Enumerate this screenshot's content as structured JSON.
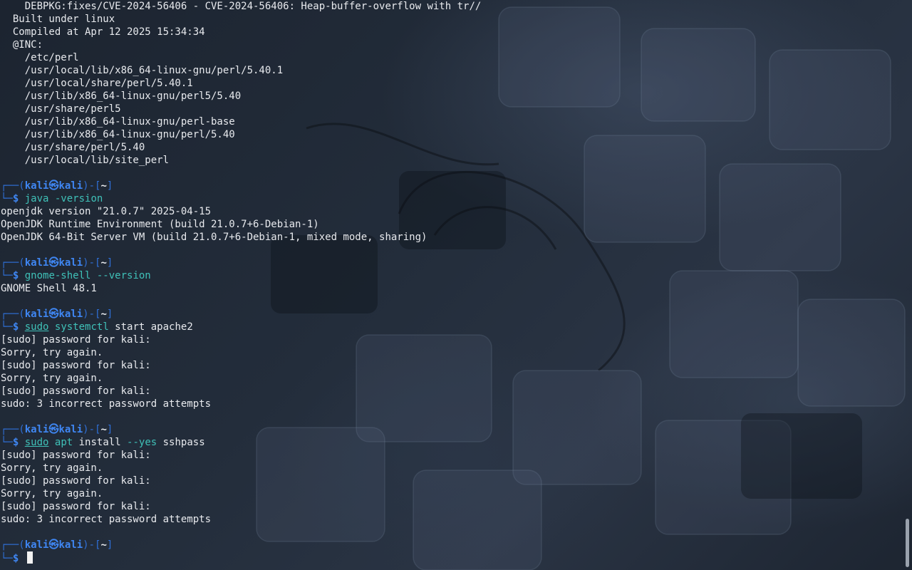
{
  "terminal": {
    "perl_output": [
      "    DEBPKG:fixes/CVE-2024-56406 - CVE-2024-56406: Heap-buffer-overflow with tr//",
      "  Built under linux",
      "  Compiled at Apr 12 2025 15:34:34",
      "  @INC:",
      "    /etc/perl",
      "    /usr/local/lib/x86_64-linux-gnu/perl/5.40.1",
      "    /usr/local/share/perl/5.40.1",
      "    /usr/lib/x86_64-linux-gnu/perl5/5.40",
      "    /usr/share/perl5",
      "    /usr/lib/x86_64-linux-gnu/perl-base",
      "    /usr/lib/x86_64-linux-gnu/perl/5.40",
      "    /usr/share/perl/5.40",
      "    /usr/local/lib/site_perl"
    ],
    "prompt": {
      "top_left": "┌──(",
      "user": "kali",
      "at": "㉿",
      "host": "kali",
      "mid": ")-[",
      "dir": "~",
      "close": "]",
      "bottom_left": "└─",
      "dollar": "$"
    },
    "blocks": [
      {
        "command": [
          {
            "text": "java",
            "style": "cmd"
          },
          {
            "text": " -version",
            "style": "flag"
          }
        ],
        "output": [
          "openjdk version \"21.0.7\" 2025-04-15",
          "OpenJDK Runtime Environment (build 21.0.7+6-Debian-1)",
          "OpenJDK 64-Bit Server VM (build 21.0.7+6-Debian-1, mixed mode, sharing)"
        ]
      },
      {
        "command": [
          {
            "text": "gnome-shell",
            "style": "cmd"
          },
          {
            "text": " --version",
            "style": "flag"
          }
        ],
        "output": [
          "GNOME Shell 48.1"
        ]
      },
      {
        "command": [
          {
            "text": "sudo",
            "style": "sudo"
          },
          {
            "text": " ",
            "style": "plain"
          },
          {
            "text": "systemctl",
            "style": "cmd"
          },
          {
            "text": " start apache2",
            "style": "plain"
          }
        ],
        "output": [
          "[sudo] password for kali:",
          "Sorry, try again.",
          "[sudo] password for kali:",
          "Sorry, try again.",
          "[sudo] password for kali:",
          "sudo: 3 incorrect password attempts"
        ]
      },
      {
        "command": [
          {
            "text": "sudo",
            "style": "sudo"
          },
          {
            "text": " ",
            "style": "plain"
          },
          {
            "text": "apt",
            "style": "cmd"
          },
          {
            "text": " install ",
            "style": "plain"
          },
          {
            "text": "--yes",
            "style": "flag"
          },
          {
            "text": " sshpass",
            "style": "plain"
          }
        ],
        "output": [
          "[sudo] password for kali:",
          "Sorry, try again.",
          "[sudo] password for kali:",
          "Sorry, try again.",
          "[sudo] password for kali:",
          "sudo: 3 incorrect password attempts"
        ]
      }
    ],
    "scroll_position": 0.91
  }
}
